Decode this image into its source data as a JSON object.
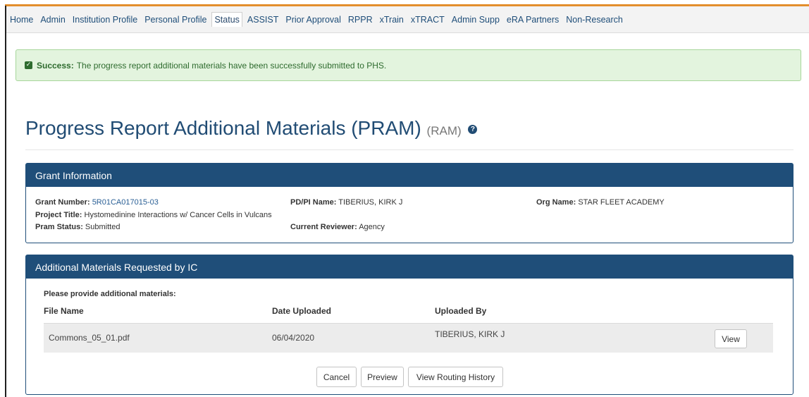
{
  "nav": {
    "items": [
      "Home",
      "Admin",
      "Institution Profile",
      "Personal Profile",
      "Status",
      "ASSIST",
      "Prior Approval",
      "RPPR",
      "xTrain",
      "xTRACT",
      "Admin Supp",
      "eRA Partners",
      "Non-Research"
    ],
    "active": "Status"
  },
  "alert": {
    "label": "Success:",
    "message": "The progress report additional materials have been successfully submitted to PHS."
  },
  "page": {
    "title": "Progress Report Additional Materials (PRAM)",
    "subtitle": "(RAM)",
    "help_icon": "question-circle-icon"
  },
  "grant_info": {
    "heading": "Grant Information",
    "grant_number_label": "Grant Number:",
    "grant_number": "5R01CA017015-03",
    "pdpi_label": "PD/PI Name:",
    "pdpi": "TIBERIUS, KIRK J",
    "org_label": "Org Name:",
    "org": "STAR FLEET ACADEMY",
    "project_title_label": "Project Title:",
    "project_title": "Hystomedinine Interactions w/ Cancer Cells in Vulcans",
    "status_label": "Pram Status:",
    "status": "Submitted",
    "reviewer_label": "Current Reviewer:",
    "reviewer": "Agency"
  },
  "materials": {
    "heading": "Additional Materials Requested by IC",
    "prompt": "Please provide additional materials:",
    "columns": [
      "File Name",
      "Date Uploaded",
      "Uploaded By"
    ],
    "rows": [
      {
        "file": "Commons_05_01.pdf",
        "date": "06/04/2020",
        "by": "TIBERIUS, KIRK J",
        "action": "View"
      }
    ]
  },
  "actions": {
    "cancel": "Cancel",
    "preview": "Preview",
    "routing": "View Routing History"
  },
  "colors": {
    "primary": "#1f4e79",
    "success_bg": "#e3f4de",
    "success_text": "#2e6b2e"
  }
}
